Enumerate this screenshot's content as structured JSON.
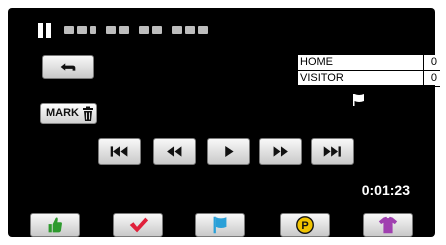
{
  "status": {
    "pause_icon": "pause-icon"
  },
  "scoreboard": {
    "home_label": "HOME",
    "home_score": "0",
    "visitor_label": "VISITOR",
    "visitor_score": "0"
  },
  "mark_button": {
    "label": "MARK",
    "icon": "trash-icon"
  },
  "transport": {
    "buttons": [
      "skip-back-icon",
      "rewind-icon",
      "play-icon",
      "fast-forward-icon",
      "skip-forward-icon"
    ]
  },
  "time": "0:01:23",
  "category_buttons": [
    {
      "icon": "thumbs-up-icon",
      "color": "#2e9a2e"
    },
    {
      "icon": "check-icon",
      "color": "#e0203a"
    },
    {
      "icon": "flag-icon",
      "color": "#2aa0d8"
    },
    {
      "icon": "p-circle-icon",
      "color": "#f0c300"
    },
    {
      "icon": "shirt-icon",
      "color": "#a040b0"
    }
  ]
}
